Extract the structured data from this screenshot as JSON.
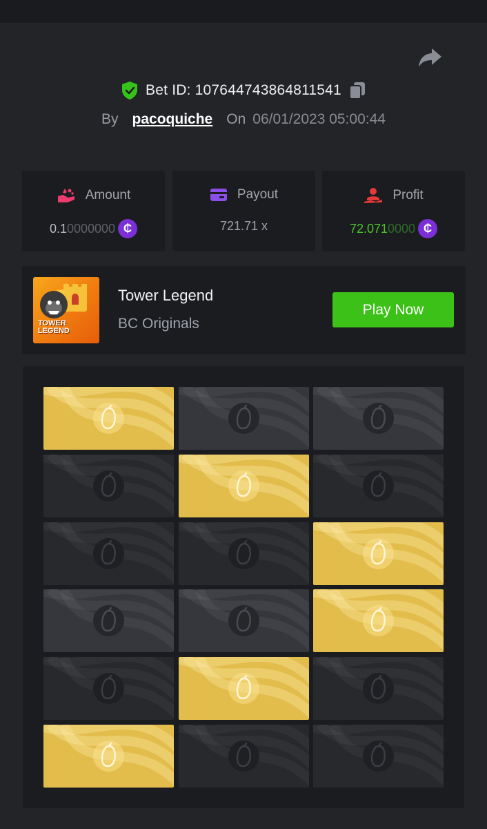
{
  "bet": {
    "id_label": "Bet ID: 107644743864811541",
    "by_label": "By",
    "username": "pacoquiche",
    "on_label": "On",
    "datetime": "06/01/2023 05:00:44"
  },
  "stats": [
    {
      "label": "Amount",
      "value_main": "0.1",
      "value_dim": "0000000",
      "main_color": "#b9bbc1",
      "icon": "hand-coins-icon"
    },
    {
      "label": "Payout",
      "value": "721.71 x",
      "icon": "card-icon"
    },
    {
      "label": "Profit",
      "value_main": "72.071",
      "value_dim": "0000",
      "main_color": "#4cc52b",
      "icon": "user-coin-icon"
    }
  ],
  "game": {
    "title": "Tower Legend",
    "subtitle": "BC Originals",
    "thumb_text": "TOWER LEGEND",
    "play_label": "Play Now"
  },
  "board": {
    "rows": [
      [
        "gold",
        "grey",
        "grey"
      ],
      [
        "dark",
        "gold",
        "dark"
      ],
      [
        "dark",
        "dark",
        "gold"
      ],
      [
        "grey",
        "grey",
        "gold"
      ],
      [
        "dark",
        "gold",
        "dark"
      ],
      [
        "gold",
        "dark",
        "dark"
      ]
    ]
  },
  "colors": {
    "accent_green": "#3bc117",
    "coin_purple": "#7b2fd6",
    "tile_gold": "#e2bd4c"
  },
  "currency_symbol": "₵"
}
